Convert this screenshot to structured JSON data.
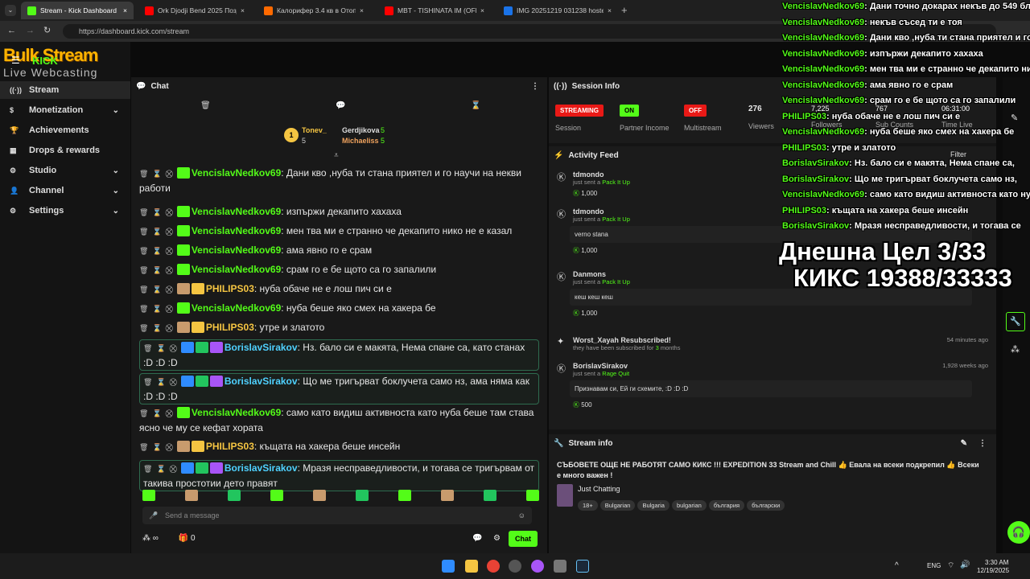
{
  "browser": {
    "tabs": [
      {
        "label": "Stream - Kick Dashboard",
        "color": "#53fc18",
        "active": true
      },
      {
        "label": "Ork Djodji Bend 2025 Поздрав",
        "color": "#ff0000"
      },
      {
        "label": "Калорифер 3.4 кв в Отоплите...",
        "color": "#ff6a00"
      },
      {
        "label": "MBT - TISHINATA IM (OFFICIAL",
        "color": "#ff0000"
      },
      {
        "label": "IMG 20251219 031238 hosted",
        "color": "#1a73e8"
      }
    ],
    "url": "https://dashboard.kick.com/stream"
  },
  "logo": {
    "line1": "Bulk Stream",
    "kick": "KICK",
    "line2": "Live Webcasting Services"
  },
  "sidebar": {
    "items": [
      {
        "label": "Stream",
        "icon": "broadcast-icon",
        "glyph": "((·))",
        "active": true
      },
      {
        "label": "Monetization",
        "icon": "dollar-icon",
        "glyph": "$",
        "chev": true
      },
      {
        "label": "Achievements",
        "icon": "trophy-icon",
        "glyph": "🏆"
      },
      {
        "label": "Drops & rewards",
        "icon": "gift-icon",
        "glyph": "▦"
      },
      {
        "label": "Studio",
        "icon": "gear-icon",
        "glyph": "⚙",
        "chev": true
      },
      {
        "label": "Channel",
        "icon": "user-icon",
        "glyph": "👤",
        "chev": true
      },
      {
        "label": "Settings",
        "icon": "settings-icon",
        "glyph": "⚙",
        "chev": true
      }
    ]
  },
  "chat": {
    "title": "Chat",
    "leaders": [
      {
        "name": "Tonev_",
        "count": "5"
      },
      {
        "name": "Gerdjikova",
        "count": "5"
      },
      {
        "name": "Michaeliss",
        "count": "5"
      }
    ],
    "messages": [
      {
        "user": "VencislavNedkov69",
        "color": "g",
        "text": "Дани кво ,нуба ти стана приятел и го научи на некви работи"
      },
      {
        "user": "VencislavNedkov69",
        "color": "g",
        "text": "изпържи декапито хахаха"
      },
      {
        "user": "VencislavNedkov69",
        "color": "g",
        "text": "мен тва ми е странно че декапито нико не е казал"
      },
      {
        "user": "VencislavNedkov69",
        "color": "g",
        "text": "ама явно го е срам"
      },
      {
        "user": "VencislavNedkov69",
        "color": "g",
        "text": "срам го е бе щото са го запалили"
      },
      {
        "user": "PHILIPS03",
        "color": "y",
        "text": "нуба обаче не е лош пич си е"
      },
      {
        "user": "VencislavNedkov69",
        "color": "g",
        "text": "нуба беше яко смех на хакера бе"
      },
      {
        "user": "PHILIPS03",
        "color": "y",
        "text": "утре и златото"
      },
      {
        "user": "BorislavSirakov",
        "color": "b",
        "text": "Нз. бало си е макята, Нема спане са, като станах :D :D :D",
        "hl": true
      },
      {
        "user": "BorislavSirakov",
        "color": "b",
        "text": "Що ме тригърват боклучета само нз, ама няма как :D :D :D",
        "hl": true
      },
      {
        "user": "VencislavNedkov69",
        "color": "g",
        "text": "само като видиш активноста като нуба беше там става ясно че му се кефат хората"
      },
      {
        "user": "PHILIPS03",
        "color": "y",
        "text": "къщата на хакера беше инсейн"
      },
      {
        "user": "BorislavSirakov",
        "color": "b",
        "text": "Мразя несправедливости, и тогава се тригървам от такива простотии дето правят",
        "hl": true
      }
    ],
    "input_placeholder": "Send a message",
    "footer_points": "∞",
    "footer_count": "0",
    "chat_button": "Chat"
  },
  "session": {
    "title": "Session Info",
    "status": [
      {
        "pill": "STREAMING",
        "label": "Session",
        "color": "#e91916"
      },
      {
        "pill": "ON",
        "label": "Partner Income",
        "color": "#53fc18"
      },
      {
        "pill": "OFF",
        "label": "Multistream",
        "color": "#e91916"
      }
    ],
    "viewers": {
      "value": "276",
      "label": "Viewers"
    },
    "followers": {
      "value": "7,225",
      "label": "Followers"
    },
    "subs": {
      "value": "767",
      "label": "Sub Counts"
    },
    "time": {
      "value": "06:31:00",
      "label": "Time Live"
    }
  },
  "activity": {
    "title": "Activity Feed",
    "filter": "Filter",
    "items": [
      {
        "user": "tdmondo",
        "action": "just sent a",
        "item": "Pack It Up",
        "amount": "1,000",
        "time": ""
      },
      {
        "user": "tdmondo",
        "action": "just sent a",
        "item": "Pack It Up",
        "message": "verno stana",
        "amount": "1,000",
        "time": ""
      },
      {
        "user": "Danmons",
        "action": "just sent a",
        "item": "Pack It Up",
        "message": "кеш кеш кеш",
        "amount": "1,000",
        "time": ""
      },
      {
        "user": "Worst_Xayah Resubscribed!",
        "action": "they have been subscribed for",
        "item": "3",
        "suffix": "months",
        "time": "54 minutes ago"
      },
      {
        "user": "BorislavSirakov",
        "action": "just sent a",
        "item": "Rage Quit",
        "message": "Признавам си, Ей ги схемите, :D :D :D",
        "amount": "500",
        "time": "1,928 weeks ago"
      }
    ]
  },
  "stream_info": {
    "title": "Stream info",
    "stream_title": "СЪБОВЕТЕ ОЩЕ НЕ РАБОТЯТ САМО КИКС !!! EXPEDITION 33 Stream and Chill 👍 Евала на всеки подкрепил 👍 Всеки е много важен !",
    "category": "Just Chatting",
    "tags": [
      "18+",
      "Bulgarian",
      "Bulgaria",
      "bulgarian",
      "българия",
      "български"
    ]
  },
  "overlay": {
    "lines": [
      {
        "user": "VencislavNedkov69",
        "text": ": Дани точно докарах некъв до 549 бло"
      },
      {
        "user": "VencislavNedkov69",
        "text": ": некъв съсед ти е тоя"
      },
      {
        "user": "VencislavNedkov69",
        "text": ": Дани кво ,нуба ти стана приятел и го н"
      },
      {
        "user": "VencislavNedkov69",
        "text": ": изпържи декапито хахаха"
      },
      {
        "user": "VencislavNedkov69",
        "text": ": мен тва ми е странно че декапито ни"
      },
      {
        "user": "VencislavNedkov69",
        "text": ": ама явно го е срам"
      },
      {
        "user": "VencislavNedkov69",
        "text": ": срам го е бе щото са го запалили"
      },
      {
        "user": "PHILIPS03",
        "text": ": нуба обаче не е лош пич си е"
      },
      {
        "user": "VencislavNedkov69",
        "text": ": нуба беше яко смех на хакера бе"
      },
      {
        "user": "PHILIPS03",
        "text": ": утре и златото"
      },
      {
        "user": "BorislavSirakov",
        "text": ": Нз. бало си е макята, Нема спане са,"
      },
      {
        "user": "BorislavSirakov",
        "text": ": Що ме тригърват боклучета само нз,"
      },
      {
        "user": "VencislavNedkov69",
        "text": ": само като видиш активноста като нуб"
      },
      {
        "user": "PHILIPS03",
        "text": ": къщата на хакера беше инсейн"
      },
      {
        "user": "BorislavSirakov",
        "text": ": Мразя несправедливости, и тогава се"
      }
    ],
    "goal_line1": "Днешна Цел 3/33",
    "goal_line2": "КИКС 19388/33333"
  },
  "taskbar": {
    "lang": "ENG",
    "time": "3:30 AM",
    "date": "12/19/2025"
  }
}
